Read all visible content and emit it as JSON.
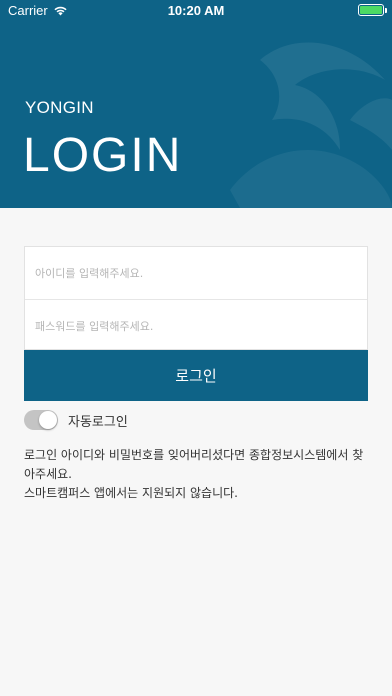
{
  "status_bar": {
    "carrier": "Carrier",
    "time": "10:20 AM",
    "battery_level": 1.0
  },
  "header": {
    "subtitle": "YONGIN",
    "title": "LOGIN"
  },
  "form": {
    "id_placeholder": "아이디를 입력해주세요.",
    "password_placeholder": "패스워드를 입력해주세요.",
    "login_label": "로그인"
  },
  "auto_login": {
    "label": "자동로그인",
    "enabled": false
  },
  "notice": {
    "line1": "로그인 아이디와 비밀번호를 잊어버리셨다면 종합정보시스템에서 찾아주세요.",
    "line2": "스마트캠퍼스 앱에서는 지원되지 않습니다."
  },
  "colors": {
    "brand": "#0e6387",
    "battery": "#4cd964",
    "toggle_off": "#c4c4c4"
  }
}
